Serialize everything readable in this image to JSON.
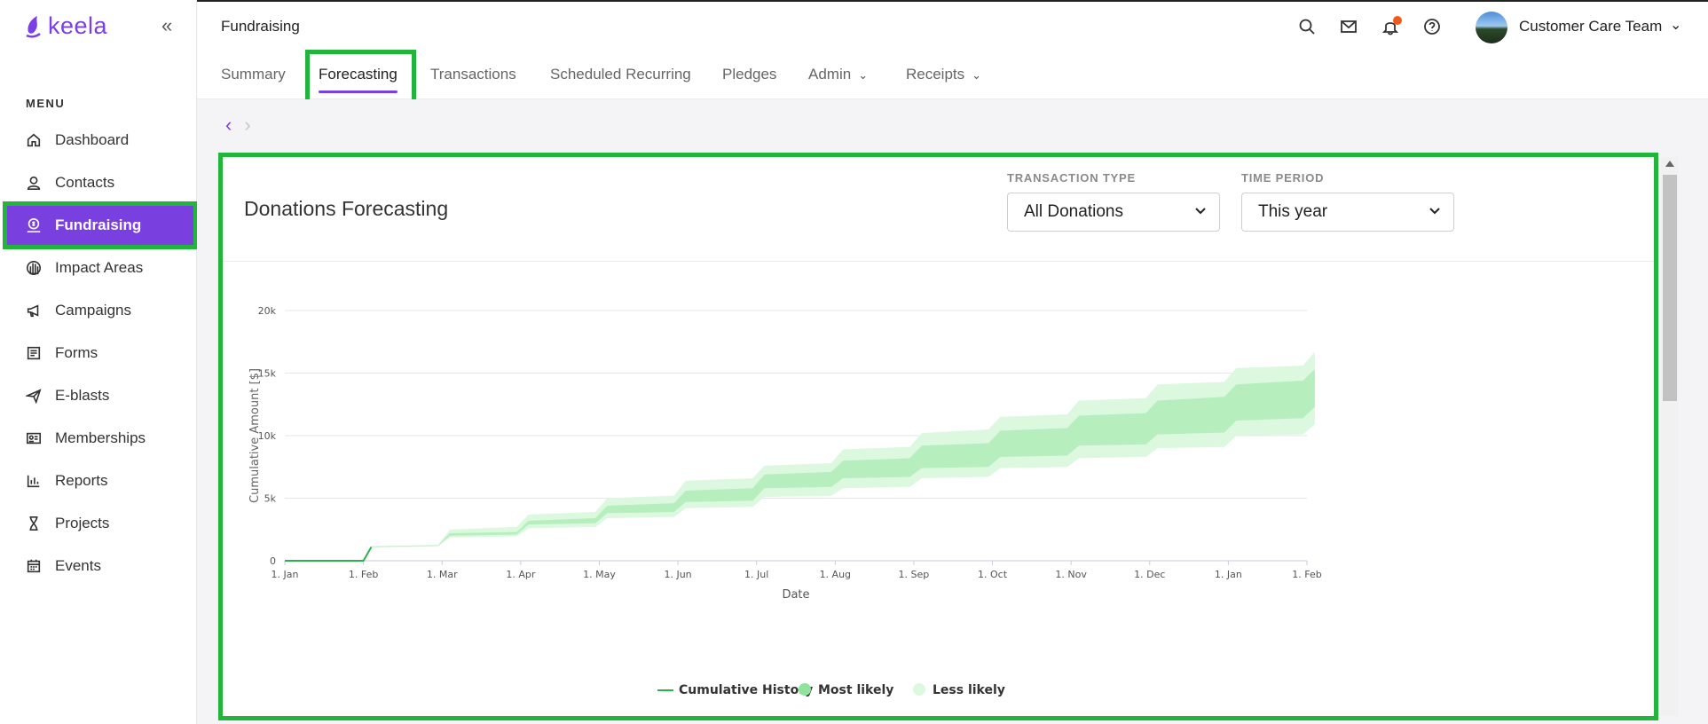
{
  "app": {
    "brand": "keela",
    "collapse_icon": "double-chevron-left-icon"
  },
  "sidebar": {
    "menu_title": "MENU",
    "items": [
      {
        "label": "Dashboard",
        "icon": "home-icon"
      },
      {
        "label": "Contacts",
        "icon": "user-icon"
      },
      {
        "label": "Fundraising",
        "icon": "donation-icon",
        "active": true
      },
      {
        "label": "Impact Areas",
        "icon": "hand-icon"
      },
      {
        "label": "Campaigns",
        "icon": "megaphone-icon"
      },
      {
        "label": "Forms",
        "icon": "form-icon"
      },
      {
        "label": "E-blasts",
        "icon": "paper-plane-icon"
      },
      {
        "label": "Memberships",
        "icon": "id-card-icon"
      },
      {
        "label": "Reports",
        "icon": "bar-chart-icon"
      },
      {
        "label": "Projects",
        "icon": "hourglass-icon"
      },
      {
        "label": "Events",
        "icon": "calendar-icon"
      }
    ]
  },
  "header": {
    "title": "Fundraising",
    "user_name": "Customer Care Team",
    "icons": [
      "search-icon",
      "mail-icon",
      "bell-icon",
      "help-icon"
    ]
  },
  "tabs": [
    {
      "label": "Summary"
    },
    {
      "label": "Forecasting",
      "active": true
    },
    {
      "label": "Transactions"
    },
    {
      "label": "Scheduled Recurring"
    },
    {
      "label": "Pledges"
    },
    {
      "label": "Admin",
      "dropdown": true
    },
    {
      "label": "Receipts",
      "dropdown": true
    }
  ],
  "card": {
    "title": "Donations Forecasting",
    "transaction_type": {
      "label": "TRANSACTION TYPE",
      "value": "All Donations"
    },
    "time_period": {
      "label": "TIME PERIOD",
      "value": "This year"
    }
  },
  "colors": {
    "accent": "#7a3fdf",
    "highlight": "#22b53c",
    "history_line": "#2ab24f",
    "most_likely": "#b6efbd",
    "less_likely": "#dcf8df"
  },
  "chart_data": {
    "type": "area",
    "xlabel": "Date",
    "ylabel": "Cumulative Amount [$]",
    "ylim": [
      0,
      20000
    ],
    "y_ticks": [
      "0",
      "5k",
      "10k",
      "15k",
      "20k"
    ],
    "x_ticks": [
      "1. Jan",
      "1. Feb",
      "1. Mar",
      "1. Apr",
      "1. May",
      "1. Jun",
      "1. Jul",
      "1. Aug",
      "1. Sep",
      "1. Oct",
      "1. Nov",
      "1. Dec",
      "1. Jan",
      "1. Feb"
    ],
    "grid": true,
    "legend_position": "bottom-center",
    "legend": [
      "Cumulative History",
      "Most likely",
      "Less likely"
    ],
    "history": {
      "name": "Cumulative History",
      "x": [
        0,
        0.05,
        0.95,
        1.0,
        1.1
      ],
      "y": [
        0,
        0,
        0,
        0,
        1100
      ]
    },
    "forecast": {
      "x": [
        1.1,
        1.95,
        2.1,
        2.95,
        3.1,
        3.95,
        4.1,
        4.95,
        5.1,
        5.95,
        6.1,
        6.95,
        7.1,
        7.95,
        8.1,
        8.95,
        9.1,
        9.95,
        10.1,
        10.95,
        11.1,
        11.95,
        12.1,
        12.95,
        13.1
      ],
      "most_likely_low": [
        1100,
        1200,
        2000,
        2100,
        2900,
        3000,
        3800,
        3900,
        4700,
        4800,
        5800,
        5900,
        6600,
        6700,
        7400,
        7500,
        8300,
        8400,
        9200,
        9300,
        10100,
        10250,
        11200,
        11400,
        12300
      ],
      "most_likely_high": [
        1150,
        1250,
        2200,
        2300,
        3200,
        3400,
        4400,
        4600,
        5600,
        5800,
        6900,
        7100,
        8000,
        8200,
        9200,
        9400,
        10400,
        10600,
        11600,
        11800,
        12800,
        13100,
        14100,
        14400,
        15300
      ],
      "less_likely_low": [
        1050,
        1150,
        1850,
        1950,
        2600,
        2700,
        3400,
        3500,
        4200,
        4300,
        5100,
        5200,
        5800,
        5900,
        6600,
        6700,
        7400,
        7500,
        8200,
        8300,
        9000,
        9100,
        10000,
        10100,
        10900
      ],
      "less_likely_high": [
        1150,
        1250,
        2500,
        2700,
        3700,
        3900,
        5000,
        5200,
        6400,
        6600,
        7600,
        7800,
        8900,
        9100,
        10200,
        10500,
        11500,
        11700,
        12800,
        13000,
        14100,
        14300,
        15400,
        15600,
        16700
      ]
    }
  }
}
